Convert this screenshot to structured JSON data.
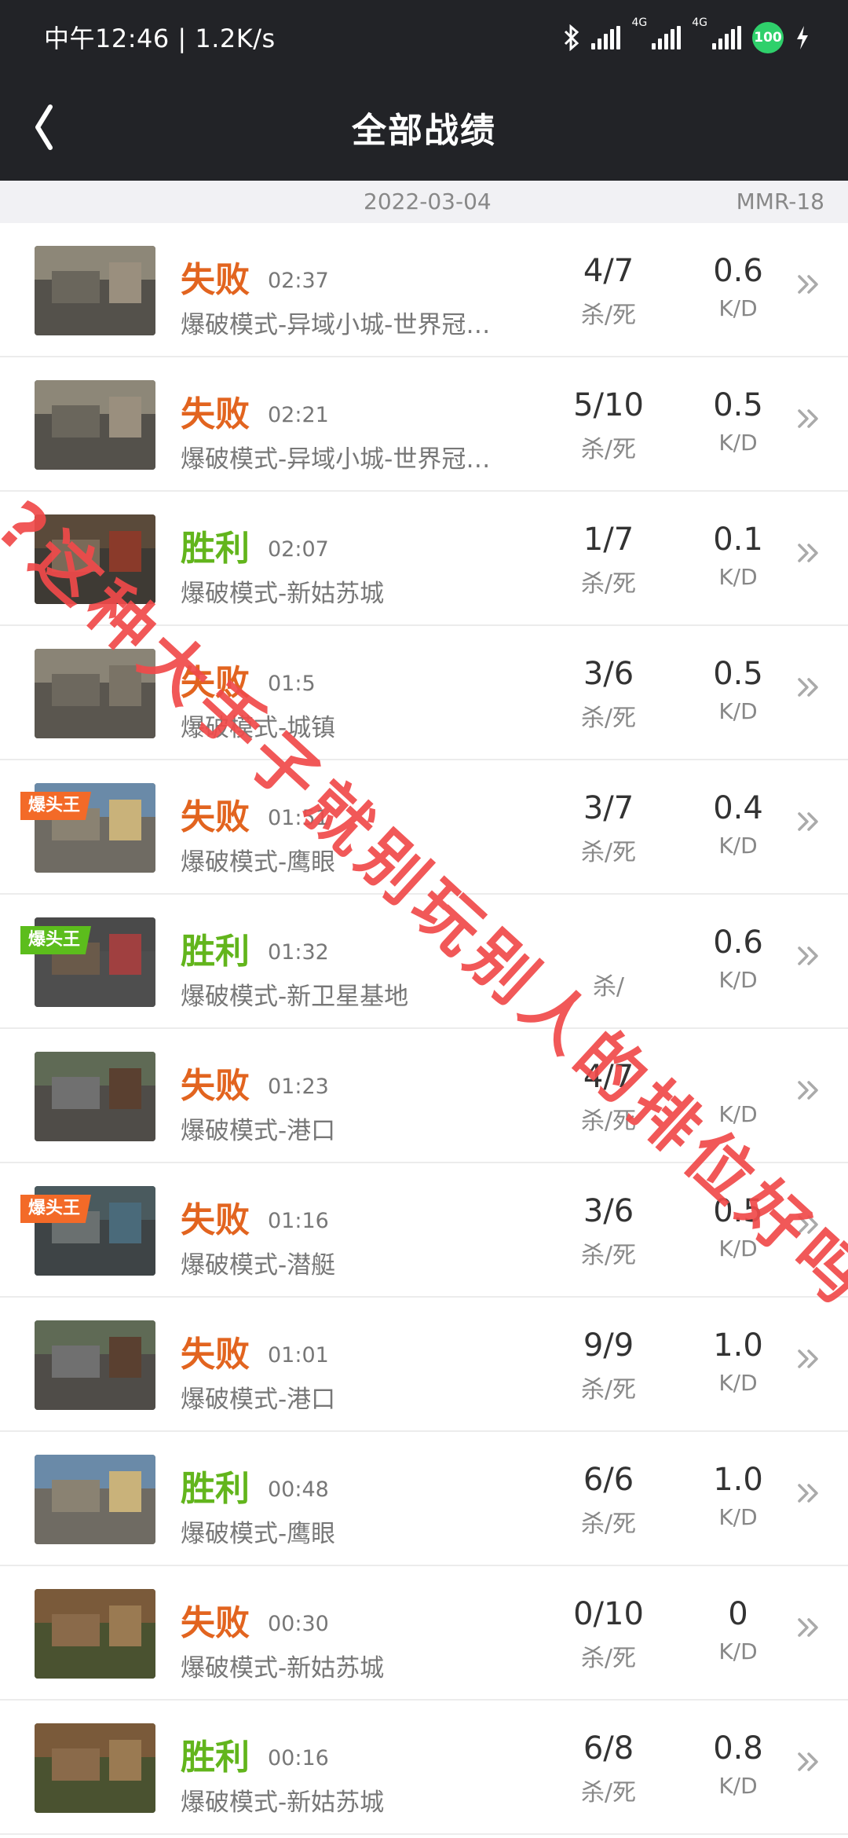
{
  "status_bar": {
    "time_speed": "中午12:46 | 1.2K/s",
    "net_label_1": "4G",
    "net_label_2": "4G",
    "battery": "100",
    "icons": [
      "bluetooth-icon",
      "signal-icon",
      "signal-icon",
      "battery-icon",
      "charging-icon"
    ]
  },
  "header": {
    "title": "全部战绩",
    "back_icon": "chevron-left-icon"
  },
  "subheader": {
    "date": "2022-03-04",
    "mmr": "MMR-18"
  },
  "colors": {
    "lose": "#e2641f",
    "win": "#62b51c",
    "badge_orange": "#f36a28",
    "badge_green": "#5cbd1c",
    "watermark": "#f04a4a"
  },
  "watermark_text": "?这种大手子就别玩别人的排位好吗",
  "matches": [
    {
      "result": "失败",
      "outcome": "lose",
      "time": "02:37",
      "mode": "爆破模式-异域小城-世界冠军杯",
      "kd": "4/7",
      "kd_label": "杀/死",
      "ratio": "0.6",
      "ratio_label": "K/D",
      "badge": ""
    },
    {
      "result": "失败",
      "outcome": "lose",
      "time": "02:21",
      "mode": "爆破模式-异域小城-世界冠军杯",
      "kd": "5/10",
      "kd_label": "杀/死",
      "ratio": "0.5",
      "ratio_label": "K/D",
      "badge": ""
    },
    {
      "result": "胜利",
      "outcome": "win",
      "time": "02:07",
      "mode": "爆破模式-新姑苏城",
      "kd": "1/7",
      "kd_label": "杀/死",
      "ratio": "0.1",
      "ratio_label": "K/D",
      "badge": ""
    },
    {
      "result": "失败",
      "outcome": "lose",
      "time": "01:5",
      "mode": "爆破模式-城镇",
      "kd": "3/6",
      "kd_label": "杀/死",
      "ratio": "0.5",
      "ratio_label": "K/D",
      "badge": ""
    },
    {
      "result": "失败",
      "outcome": "lose",
      "time": "01:51",
      "mode": "爆破模式-鹰眼",
      "kd": "3/7",
      "kd_label": "杀/死",
      "ratio": "0.4",
      "ratio_label": "K/D",
      "badge": "爆头王",
      "badge_color": "orange"
    },
    {
      "result": "胜利",
      "outcome": "win",
      "time": "01:32",
      "mode": "爆破模式-新卫星基地",
      "kd": "",
      "kd_label": "杀/",
      "ratio": "0.6",
      "ratio_label": "K/D",
      "badge": "爆头王",
      "badge_color": "green"
    },
    {
      "result": "失败",
      "outcome": "lose",
      "time": "01:23",
      "mode": "爆破模式-港口",
      "kd": "4/7",
      "kd_label": "杀/死",
      "ratio": "",
      "ratio_label": "K/D",
      "badge": ""
    },
    {
      "result": "失败",
      "outcome": "lose",
      "time": "01:16",
      "mode": "爆破模式-潜艇",
      "kd": "3/6",
      "kd_label": "杀/死",
      "ratio": "0.5",
      "ratio_label": "K/D",
      "badge": "爆头王",
      "badge_color": "orange"
    },
    {
      "result": "失败",
      "outcome": "lose",
      "time": "01:01",
      "mode": "爆破模式-港口",
      "kd": "9/9",
      "kd_label": "杀/死",
      "ratio": "1.0",
      "ratio_label": "K/D",
      "badge": ""
    },
    {
      "result": "胜利",
      "outcome": "win",
      "time": "00:48",
      "mode": "爆破模式-鹰眼",
      "kd": "6/6",
      "kd_label": "杀/死",
      "ratio": "1.0",
      "ratio_label": "K/D",
      "badge": ""
    },
    {
      "result": "失败",
      "outcome": "lose",
      "time": "00:30",
      "mode": "爆破模式-新姑苏城",
      "kd": "0/10",
      "kd_label": "杀/死",
      "ratio": "0",
      "ratio_label": "K/D",
      "badge": ""
    },
    {
      "result": "胜利",
      "outcome": "win",
      "time": "00:16",
      "mode": "爆破模式-新姑苏城",
      "kd": "6/8",
      "kd_label": "杀/死",
      "ratio": "0.8",
      "ratio_label": "K/D",
      "badge": ""
    }
  ]
}
